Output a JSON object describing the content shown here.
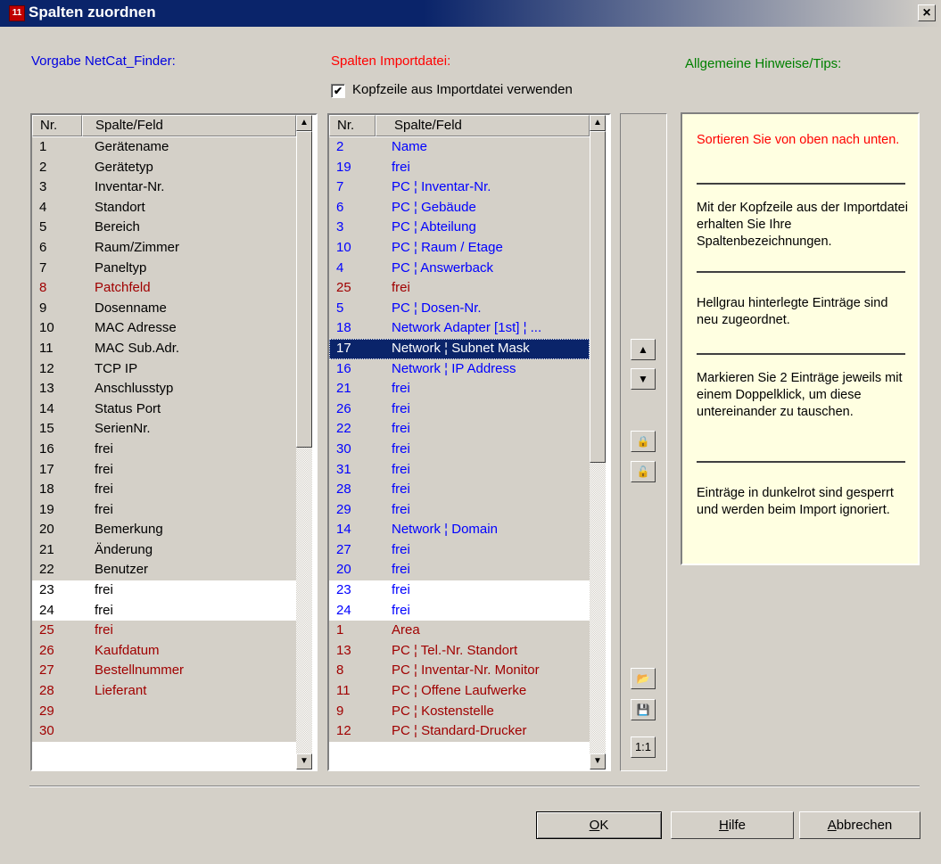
{
  "window": {
    "title": "Spalten zuordnen",
    "close_label": "×",
    "icon_label": "11"
  },
  "labels": {
    "left": "Vorgabe NetCat_Finder:",
    "middle": "Spalten Importdatei:",
    "right": "Allgemeine Hinweise/Tips:"
  },
  "checkbox": {
    "checked": true,
    "label": "Kopfzeile aus Importdatei verwenden"
  },
  "left_list": {
    "headers": {
      "nr": "Nr.",
      "field": "Spalte/Feld"
    },
    "rows": [
      {
        "nr": "1",
        "field": "Gerätename",
        "style": "gray",
        "color": "black"
      },
      {
        "nr": "2",
        "field": "Gerätetyp",
        "style": "gray",
        "color": "black"
      },
      {
        "nr": "3",
        "field": "Inventar-Nr.",
        "style": "gray",
        "color": "black"
      },
      {
        "nr": "4",
        "field": "Standort",
        "style": "gray",
        "color": "black"
      },
      {
        "nr": "5",
        "field": "Bereich",
        "style": "gray",
        "color": "black"
      },
      {
        "nr": "6",
        "field": "Raum/Zimmer",
        "style": "gray",
        "color": "black"
      },
      {
        "nr": "7",
        "field": "Paneltyp",
        "style": "gray",
        "color": "black"
      },
      {
        "nr": "8",
        "field": "Patchfeld",
        "style": "gray",
        "color": "red"
      },
      {
        "nr": "9",
        "field": "Dosenname",
        "style": "gray",
        "color": "black"
      },
      {
        "nr": "10",
        "field": "MAC Adresse",
        "style": "gray",
        "color": "black"
      },
      {
        "nr": "11",
        "field": "MAC Sub.Adr.",
        "style": "gray",
        "color": "black"
      },
      {
        "nr": "12",
        "field": "TCP IP",
        "style": "gray",
        "color": "black"
      },
      {
        "nr": "13",
        "field": "Anschlusstyp",
        "style": "gray",
        "color": "black"
      },
      {
        "nr": "14",
        "field": "Status Port",
        "style": "gray",
        "color": "black"
      },
      {
        "nr": "15",
        "field": "SerienNr.",
        "style": "gray",
        "color": "black"
      },
      {
        "nr": "16",
        "field": "frei",
        "style": "gray",
        "color": "black"
      },
      {
        "nr": "17",
        "field": "frei",
        "style": "gray",
        "color": "black"
      },
      {
        "nr": "18",
        "field": "frei",
        "style": "gray",
        "color": "black"
      },
      {
        "nr": "19",
        "field": "frei",
        "style": "gray",
        "color": "black"
      },
      {
        "nr": "20",
        "field": "Bemerkung",
        "style": "gray",
        "color": "black"
      },
      {
        "nr": "21",
        "field": "Änderung",
        "style": "gray",
        "color": "black"
      },
      {
        "nr": "22",
        "field": "Benutzer",
        "style": "gray",
        "color": "black"
      },
      {
        "nr": "23",
        "field": "frei",
        "style": "white",
        "color": "black"
      },
      {
        "nr": "24",
        "field": "frei",
        "style": "white",
        "color": "black"
      },
      {
        "nr": "25",
        "field": "frei",
        "style": "gray",
        "color": "red"
      },
      {
        "nr": "26",
        "field": "Kaufdatum",
        "style": "gray",
        "color": "red"
      },
      {
        "nr": "27",
        "field": "Bestellnummer",
        "style": "gray",
        "color": "red"
      },
      {
        "nr": "28",
        "field": "Lieferant",
        "style": "gray",
        "color": "red"
      },
      {
        "nr": "29",
        "field": "",
        "style": "gray",
        "color": "red"
      },
      {
        "nr": "30",
        "field": "",
        "style": "gray",
        "color": "red"
      }
    ]
  },
  "middle_list": {
    "headers": {
      "nr": "Nr.",
      "field": "Spalte/Feld"
    },
    "rows": [
      {
        "nr": "2",
        "field": "Name",
        "style": "gray",
        "color": "blue"
      },
      {
        "nr": "19",
        "field": "frei",
        "style": "gray",
        "color": "blue"
      },
      {
        "nr": "7",
        "field": "PC ¦ Inventar-Nr.",
        "style": "gray",
        "color": "blue"
      },
      {
        "nr": "6",
        "field": "PC ¦ Gebäude",
        "style": "gray",
        "color": "blue"
      },
      {
        "nr": "3",
        "field": "PC ¦ Abteilung",
        "style": "gray",
        "color": "blue"
      },
      {
        "nr": "10",
        "field": "PC ¦ Raum / Etage",
        "style": "gray",
        "color": "blue"
      },
      {
        "nr": "4",
        "field": "PC ¦ Answerback",
        "style": "gray",
        "color": "blue"
      },
      {
        "nr": "25",
        "field": "frei",
        "style": "gray",
        "color": "red"
      },
      {
        "nr": "5",
        "field": "PC ¦ Dosen-Nr.",
        "style": "gray",
        "color": "blue"
      },
      {
        "nr": "18",
        "field": "Network Adapter [1st] ¦ ...",
        "style": "gray",
        "color": "blue"
      },
      {
        "nr": "17",
        "field": "Network ¦ Subnet Mask",
        "style": "sel",
        "color": "blue"
      },
      {
        "nr": "16",
        "field": "Network ¦ IP Address",
        "style": "gray",
        "color": "blue"
      },
      {
        "nr": "21",
        "field": "frei",
        "style": "gray",
        "color": "blue"
      },
      {
        "nr": "26",
        "field": "frei",
        "style": "gray",
        "color": "blue"
      },
      {
        "nr": "22",
        "field": "frei",
        "style": "gray",
        "color": "blue"
      },
      {
        "nr": "30",
        "field": "frei",
        "style": "gray",
        "color": "blue"
      },
      {
        "nr": "31",
        "field": "frei",
        "style": "gray",
        "color": "blue"
      },
      {
        "nr": "28",
        "field": "frei",
        "style": "gray",
        "color": "blue"
      },
      {
        "nr": "29",
        "field": "frei",
        "style": "gray",
        "color": "blue"
      },
      {
        "nr": "14",
        "field": "Network ¦ Domain",
        "style": "gray",
        "color": "blue"
      },
      {
        "nr": "27",
        "field": "frei",
        "style": "gray",
        "color": "blue"
      },
      {
        "nr": "20",
        "field": "frei",
        "style": "gray",
        "color": "blue"
      },
      {
        "nr": "23",
        "field": "frei",
        "style": "white",
        "color": "blue"
      },
      {
        "nr": "24",
        "field": "frei",
        "style": "white",
        "color": "blue"
      },
      {
        "nr": "1",
        "field": "Area",
        "style": "gray",
        "color": "red"
      },
      {
        "nr": "13",
        "field": "PC ¦ Tel.-Nr. Standort",
        "style": "gray",
        "color": "red"
      },
      {
        "nr": "8",
        "field": "PC ¦ Inventar-Nr. Monitor",
        "style": "gray",
        "color": "red"
      },
      {
        "nr": "11",
        "field": "PC ¦ Offene Laufwerke",
        "style": "gray",
        "color": "red"
      },
      {
        "nr": "9",
        "field": "PC ¦ Kostenstelle",
        "style": "gray",
        "color": "red"
      },
      {
        "nr": "12",
        "field": "PC ¦ Standard-Drucker",
        "style": "gray",
        "color": "red"
      }
    ]
  },
  "tools": {
    "move_up": "▲",
    "move_down": "▼",
    "lock": "🔒",
    "unlock": "🔓",
    "open": "📂",
    "save": "💾",
    "one_to_one": "1:1"
  },
  "tips": [
    {
      "text": "Sortieren Sie von oben nach unten.",
      "color": "#ff0000"
    },
    {
      "text": "Mit der Kopfzeile aus der Importdatei erhalten Sie Ihre Spaltenbezeichnungen.",
      "color": "#000000"
    },
    {
      "text": "Hellgrau hinterlegte Einträge sind neu zugeordnet.",
      "color": "#000000"
    },
    {
      "text": "Markieren Sie 2 Einträge jeweils mit einem Doppelklick, um diese untereinander zu tauschen.",
      "color": "#000000"
    },
    {
      "text": "Einträge in dunkelrot sind gesperrt und werden beim Import ignoriert.",
      "color": "#000000"
    }
  ],
  "buttons": {
    "ok": {
      "underline": "O",
      "rest": "K"
    },
    "help": {
      "underline": "H",
      "rest": "ilfe"
    },
    "cancel": {
      "underline": "A",
      "rest": "bbrechen"
    }
  }
}
